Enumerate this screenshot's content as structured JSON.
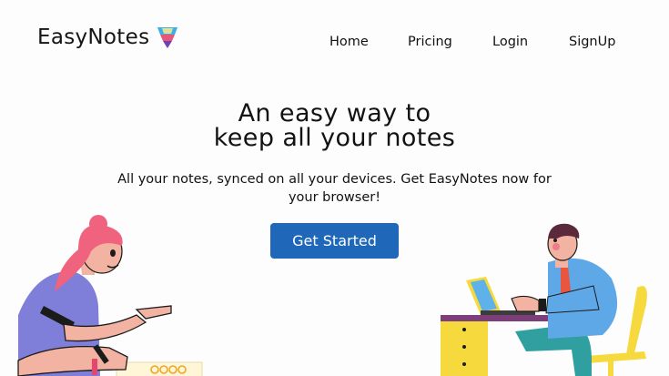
{
  "header": {
    "brand": "EasyNotes",
    "logo_icon": "notes-tray-icon"
  },
  "nav": {
    "items": [
      {
        "label": "Home"
      },
      {
        "label": "Pricing"
      },
      {
        "label": "Login"
      },
      {
        "label": "SignUp"
      }
    ]
  },
  "hero": {
    "title_line1": "An easy way to",
    "title_line2": "keep all your notes",
    "subtitle": "All your notes, synced on all your devices. Get EasyNotes now for your browser!",
    "cta_label": "Get Started"
  },
  "illustrations": {
    "left": "woman-writing-illustration",
    "right": "man-at-laptop-illustration"
  },
  "colors": {
    "accent": "#1f67b8",
    "background": "#fdfdfd",
    "text": "#111111"
  }
}
